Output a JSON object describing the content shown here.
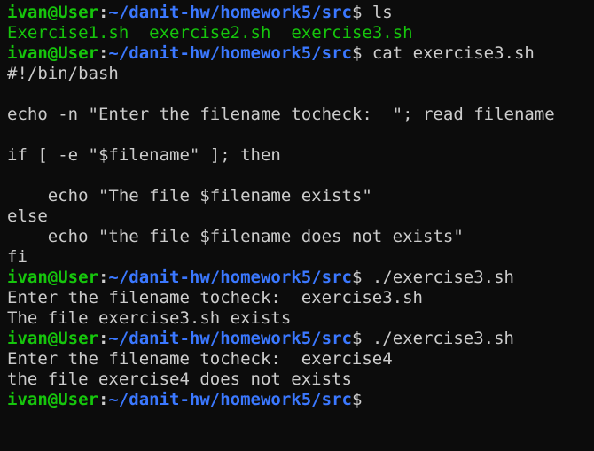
{
  "prompt": {
    "user": "ivan@User",
    "colon": ":",
    "path": "~/danit-hw/homework5/src",
    "dollar": "$"
  },
  "commands": {
    "ls": " ls",
    "cat": " cat exercise3.sh",
    "run1": " ./exercise3.sh",
    "run2": " ./exercise3.sh"
  },
  "ls_output": {
    "file1": "Exercise1.sh",
    "file2": "exercise2.sh",
    "file3": "exercise3.sh"
  },
  "script_lines": [
    "#!/bin/bash",
    "",
    "echo -n \"Enter the filename tocheck:  \"; read filename",
    "",
    "if [ -e \"$filename\" ]; then",
    "",
    "    echo \"The file $filename exists\"",
    "else",
    "    echo \"the file $filename does not exists\"",
    "fi"
  ],
  "run1_output": [
    "Enter the filename tocheck:  exercise3.sh",
    "The file exercise3.sh exists"
  ],
  "run2_output": [
    "Enter the filename tocheck:  exercise4",
    "the file exercise4 does not exists"
  ],
  "colors": {
    "background": "#0c0c0c",
    "foreground": "#cccccc",
    "user": "#16c60c",
    "path": "#3b78ff",
    "executable": "#16c60c"
  }
}
